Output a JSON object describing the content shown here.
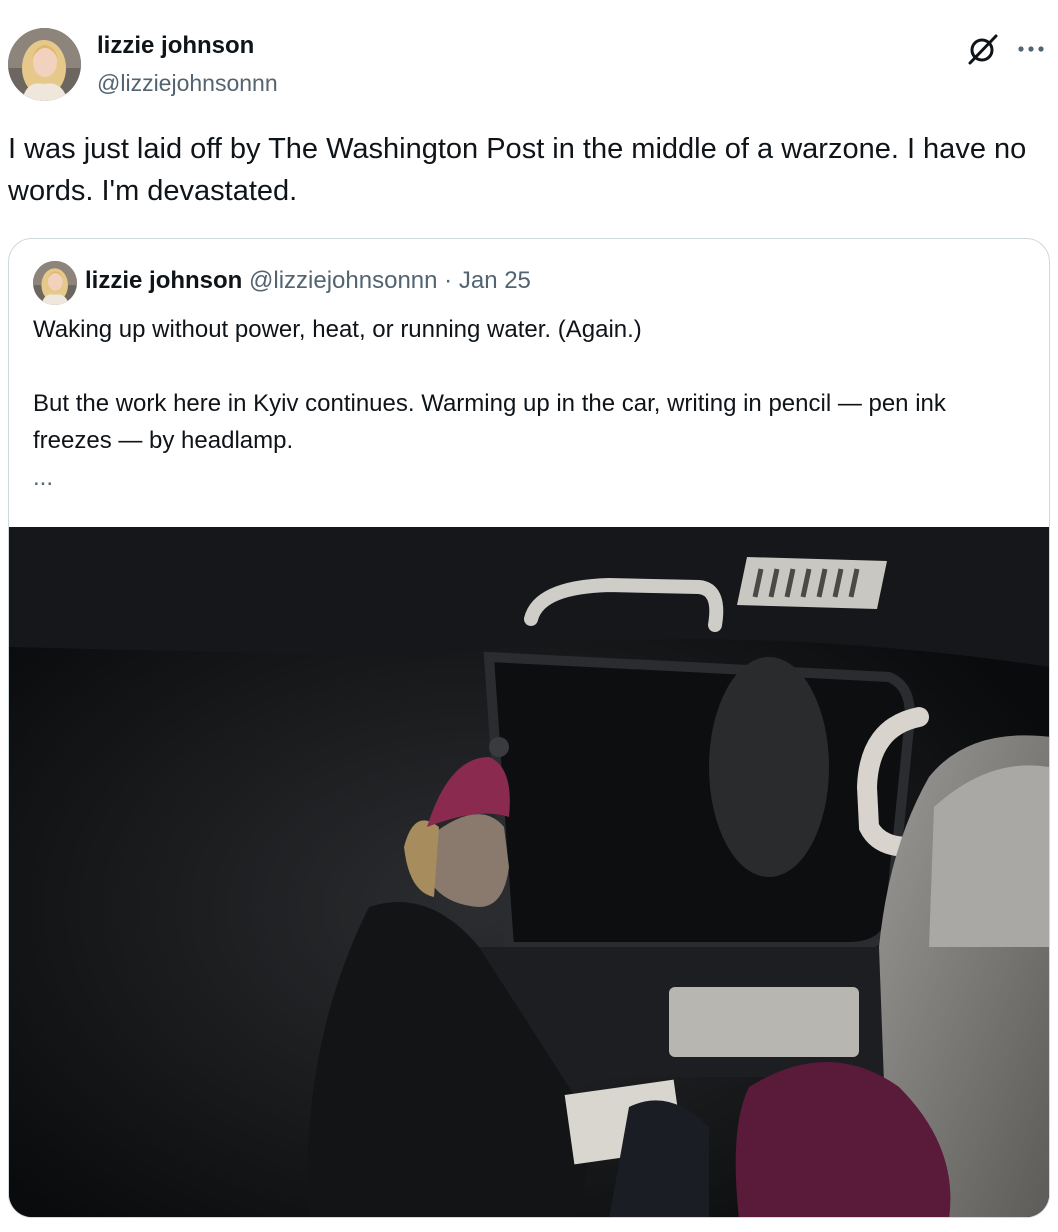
{
  "author": {
    "display_name": "lizzie johnson",
    "handle": "@lizziejohnsonnn"
  },
  "post": {
    "text": "I was just laid off by The Washington Post in the middle of a warzone. I have no words. I'm devastated."
  },
  "header_icons": [
    "grok-icon",
    "more-options-icon"
  ],
  "quoted_post": {
    "display_name": "lizzie johnson",
    "handle": "@lizziejohnsonnn",
    "separator": "·",
    "date": "Jan 25",
    "lines": [
      "Waking up without power, heat, or running water. (Again.)",
      "But the work here in Kyiv continues. Warming up in the car, writing in pencil — pen ink freezes — by headlamp."
    ],
    "truncation": "...",
    "photo_description_icon": "photo-woman-in-car-at-night"
  },
  "colors": {
    "text_primary": "#0f1419",
    "text_secondary": "#536471",
    "border": "#cfd9de",
    "hat": "#8a2a4e"
  }
}
